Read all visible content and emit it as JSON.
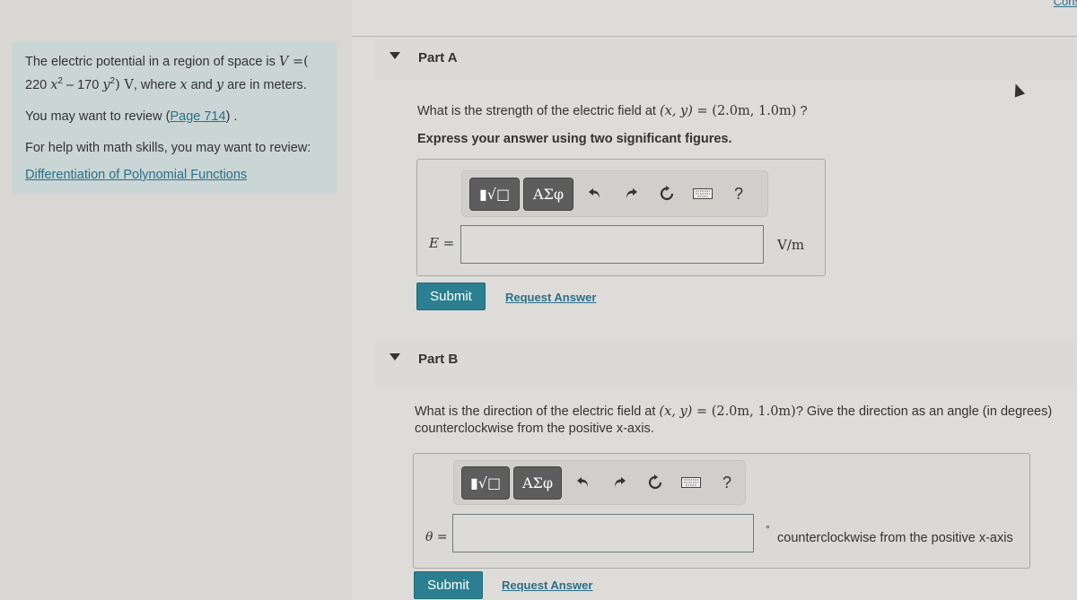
{
  "top_link": "Cons",
  "intro": {
    "line1_pre": "The electric potential in a region of space is ",
    "line1_math": "V",
    "line1_eq": " =(",
    "line2_c1": "220 ",
    "line2_x": "x",
    "line2_sup1": "2",
    "line2_minus": " – 170 ",
    "line2_y": "y",
    "line2_sup2": "2",
    "line2_close": ") V",
    "line2_post_a": ", where ",
    "line2_post_x": "x",
    "line2_post_b": " and ",
    "line2_post_y": "y",
    "line2_post_c": " are in meters.",
    "review_pre": "You may want to review (",
    "review_link": "Page 714",
    "review_post": ") .",
    "help_text": "For help with math skills, you may want to review:",
    "help_link": "Differentiation of Polynomial Functions"
  },
  "partA": {
    "title": "Part A",
    "question_pre": "What is the strength of the electric field at ",
    "question_coord": "(x, y)",
    "question_eq": " = ",
    "question_val": "(2.0m, 1.0m)",
    "question_post": " ?",
    "instruction": "Express your answer using two significant figures.",
    "toolbar": {
      "templates_label": "▮√□",
      "greek_label": "ΑΣφ",
      "help_label": "?"
    },
    "field_label": "E",
    "field_eq": " =",
    "input_value": "",
    "unit": "V/m",
    "submit_label": "Submit",
    "request_label": "Request Answer"
  },
  "partB": {
    "title": "Part B",
    "question_pre": "What is the direction of the electric field at ",
    "question_coord": "(x, y)",
    "question_eq": " = ",
    "question_val": "(2.0m, 1.0m)",
    "question_post": "? Give the direction as an angle (in degrees)",
    "question_line2": "counterclockwise from the positive x-axis.",
    "toolbar": {
      "templates_label": "▮√□",
      "greek_label": "ΑΣφ",
      "help_label": "?"
    },
    "field_label": "θ",
    "field_eq": " =",
    "input_value": "",
    "unit_degree": "°",
    "unit": "counterclockwise from the positive x-axis",
    "submit_label": "Submit",
    "request_label": "Request Answer"
  }
}
